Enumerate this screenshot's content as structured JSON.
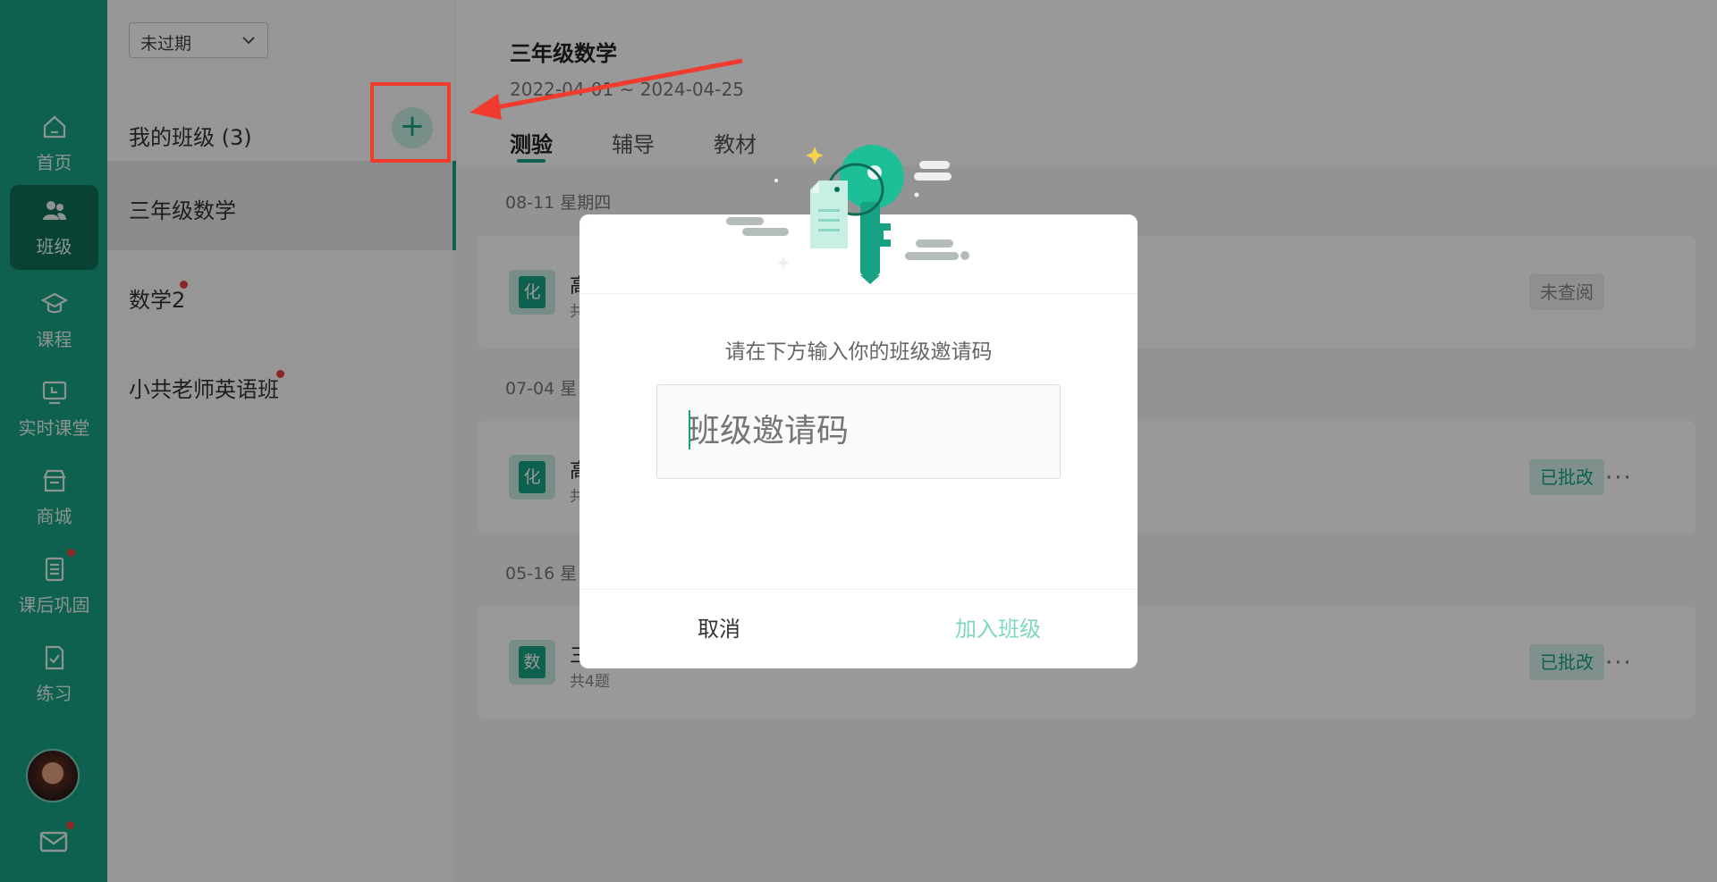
{
  "nav": {
    "items": [
      {
        "label": "首页",
        "icon": "home-icon"
      },
      {
        "label": "班级",
        "icon": "class-icon"
      },
      {
        "label": "课程",
        "icon": "course-icon"
      },
      {
        "label": "实时课堂",
        "icon": "live-class-icon"
      },
      {
        "label": "商城",
        "icon": "store-icon"
      },
      {
        "label": "课后巩固",
        "icon": "review-icon"
      },
      {
        "label": "练习",
        "icon": "practice-icon"
      }
    ],
    "active": "班级"
  },
  "classes": {
    "filter": "未过期",
    "heading": "我的班级 (3)",
    "add_label": "+",
    "items": [
      {
        "name": "三年级数学"
      },
      {
        "name": "数学2"
      },
      {
        "name": "小共老师英语班"
      }
    ]
  },
  "main": {
    "title": "三年级数学",
    "date_range": "2022-04-01 ~ 2024-04-25",
    "tabs": [
      "测验",
      "辅导",
      "教材"
    ],
    "groups": [
      {
        "date": "08-11 星期四",
        "card": {
          "subject": "化",
          "title": "高",
          "sub": "共",
          "status": "未查阅"
        }
      },
      {
        "date": "07-04 星",
        "card": {
          "subject": "化",
          "title": "高",
          "sub": "共",
          "status": "已批改"
        }
      },
      {
        "date": "05-16 星",
        "card": {
          "subject": "数",
          "title": "三",
          "sub": "共4题",
          "status": "已批改"
        }
      }
    ],
    "more": "···"
  },
  "dialog": {
    "prompt": "请在下方输入你的班级邀请码",
    "placeholder": "班级邀请码",
    "cancel": "取消",
    "join": "加入班级"
  },
  "colors": {
    "brand": "#17a283",
    "highlight": "#f03b2e"
  }
}
